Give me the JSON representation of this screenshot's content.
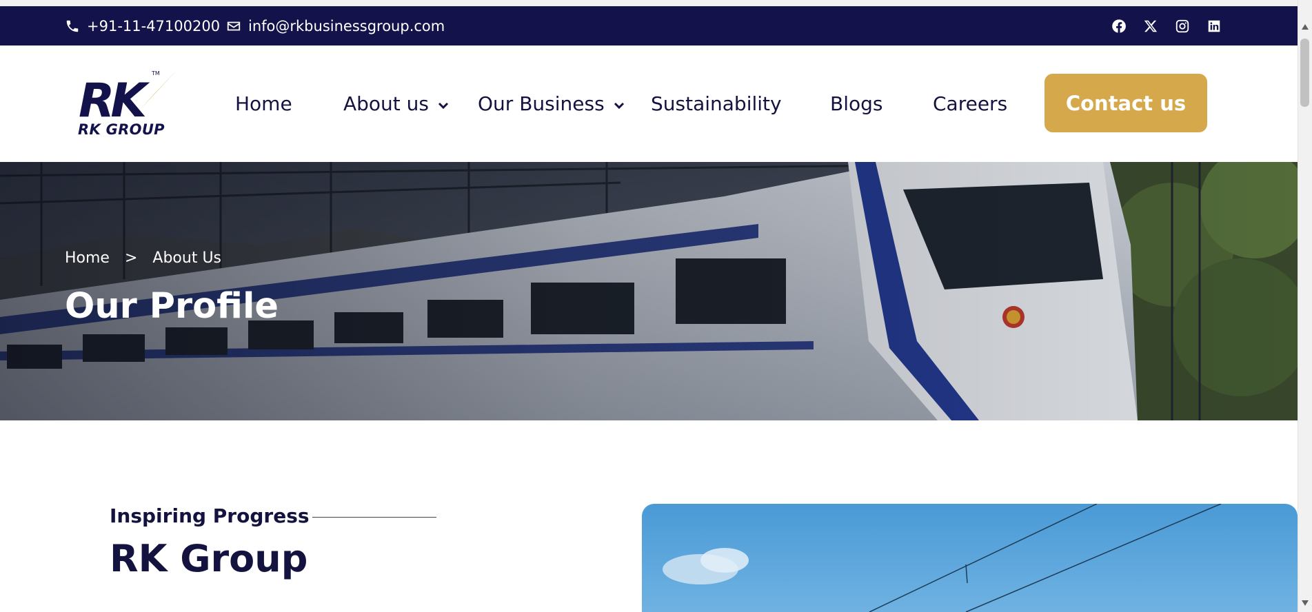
{
  "topbar": {
    "phone": "+91-11-47100200",
    "email": "info@rkbusinessgroup.com",
    "socials": [
      "facebook-icon",
      "x-icon",
      "instagram-icon",
      "linkedin-icon"
    ]
  },
  "brand": {
    "logo_text": "RK GROUP",
    "logo_mark": "RK™"
  },
  "nav": {
    "home": "Home",
    "about": "About us",
    "business": "Our Business",
    "sustainability": "Sustainability",
    "blogs": "Blogs",
    "careers": "Careers",
    "cta": "Contact us"
  },
  "hero": {
    "breadcrumb": {
      "home": "Home",
      "separator": ">",
      "current": "About Us"
    },
    "title": "Our Profile"
  },
  "intro": {
    "kicker": "Inspiring Progress",
    "title": "RK Group"
  },
  "colors": {
    "navy": "#13124a",
    "gold": "#d4a84b",
    "text": "#14123f",
    "white": "#ffffff"
  }
}
